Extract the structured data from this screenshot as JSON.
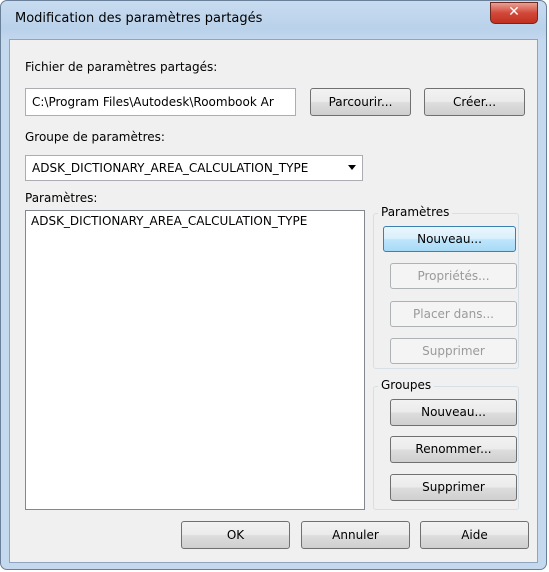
{
  "window": {
    "title": "Modification des paramètres partagés",
    "close_glyph": "✕",
    "colors": {
      "title_gradient_top": "#c8dcf0",
      "close_red": "#c2301f"
    }
  },
  "file": {
    "label": "Fichier de paramètres partagés:",
    "path": "C:\\Program Files\\Autodesk\\Roombook Ar",
    "browse_label": "Parcourir...",
    "create_label": "Créer..."
  },
  "group": {
    "label": "Groupe de paramètres:",
    "selected": "ADSK_DICTIONARY_AREA_CALCULATION_TYPE"
  },
  "parameters_list": {
    "label": "Paramètres:",
    "items": [
      "ADSK_DICTIONARY_AREA_CALCULATION_TYPE"
    ]
  },
  "param_actions": {
    "title": "Paramètres",
    "new_label": "Nouveau...",
    "properties_label": "Propriétés...",
    "move_label": "Placer dans...",
    "delete_label": "Supprimer"
  },
  "group_actions": {
    "title": "Groupes",
    "new_label": "Nouveau...",
    "rename_label": "Renommer...",
    "delete_label": "Supprimer"
  },
  "footer": {
    "ok_label": "OK",
    "cancel_label": "Annuler",
    "help_label": "Aide"
  }
}
